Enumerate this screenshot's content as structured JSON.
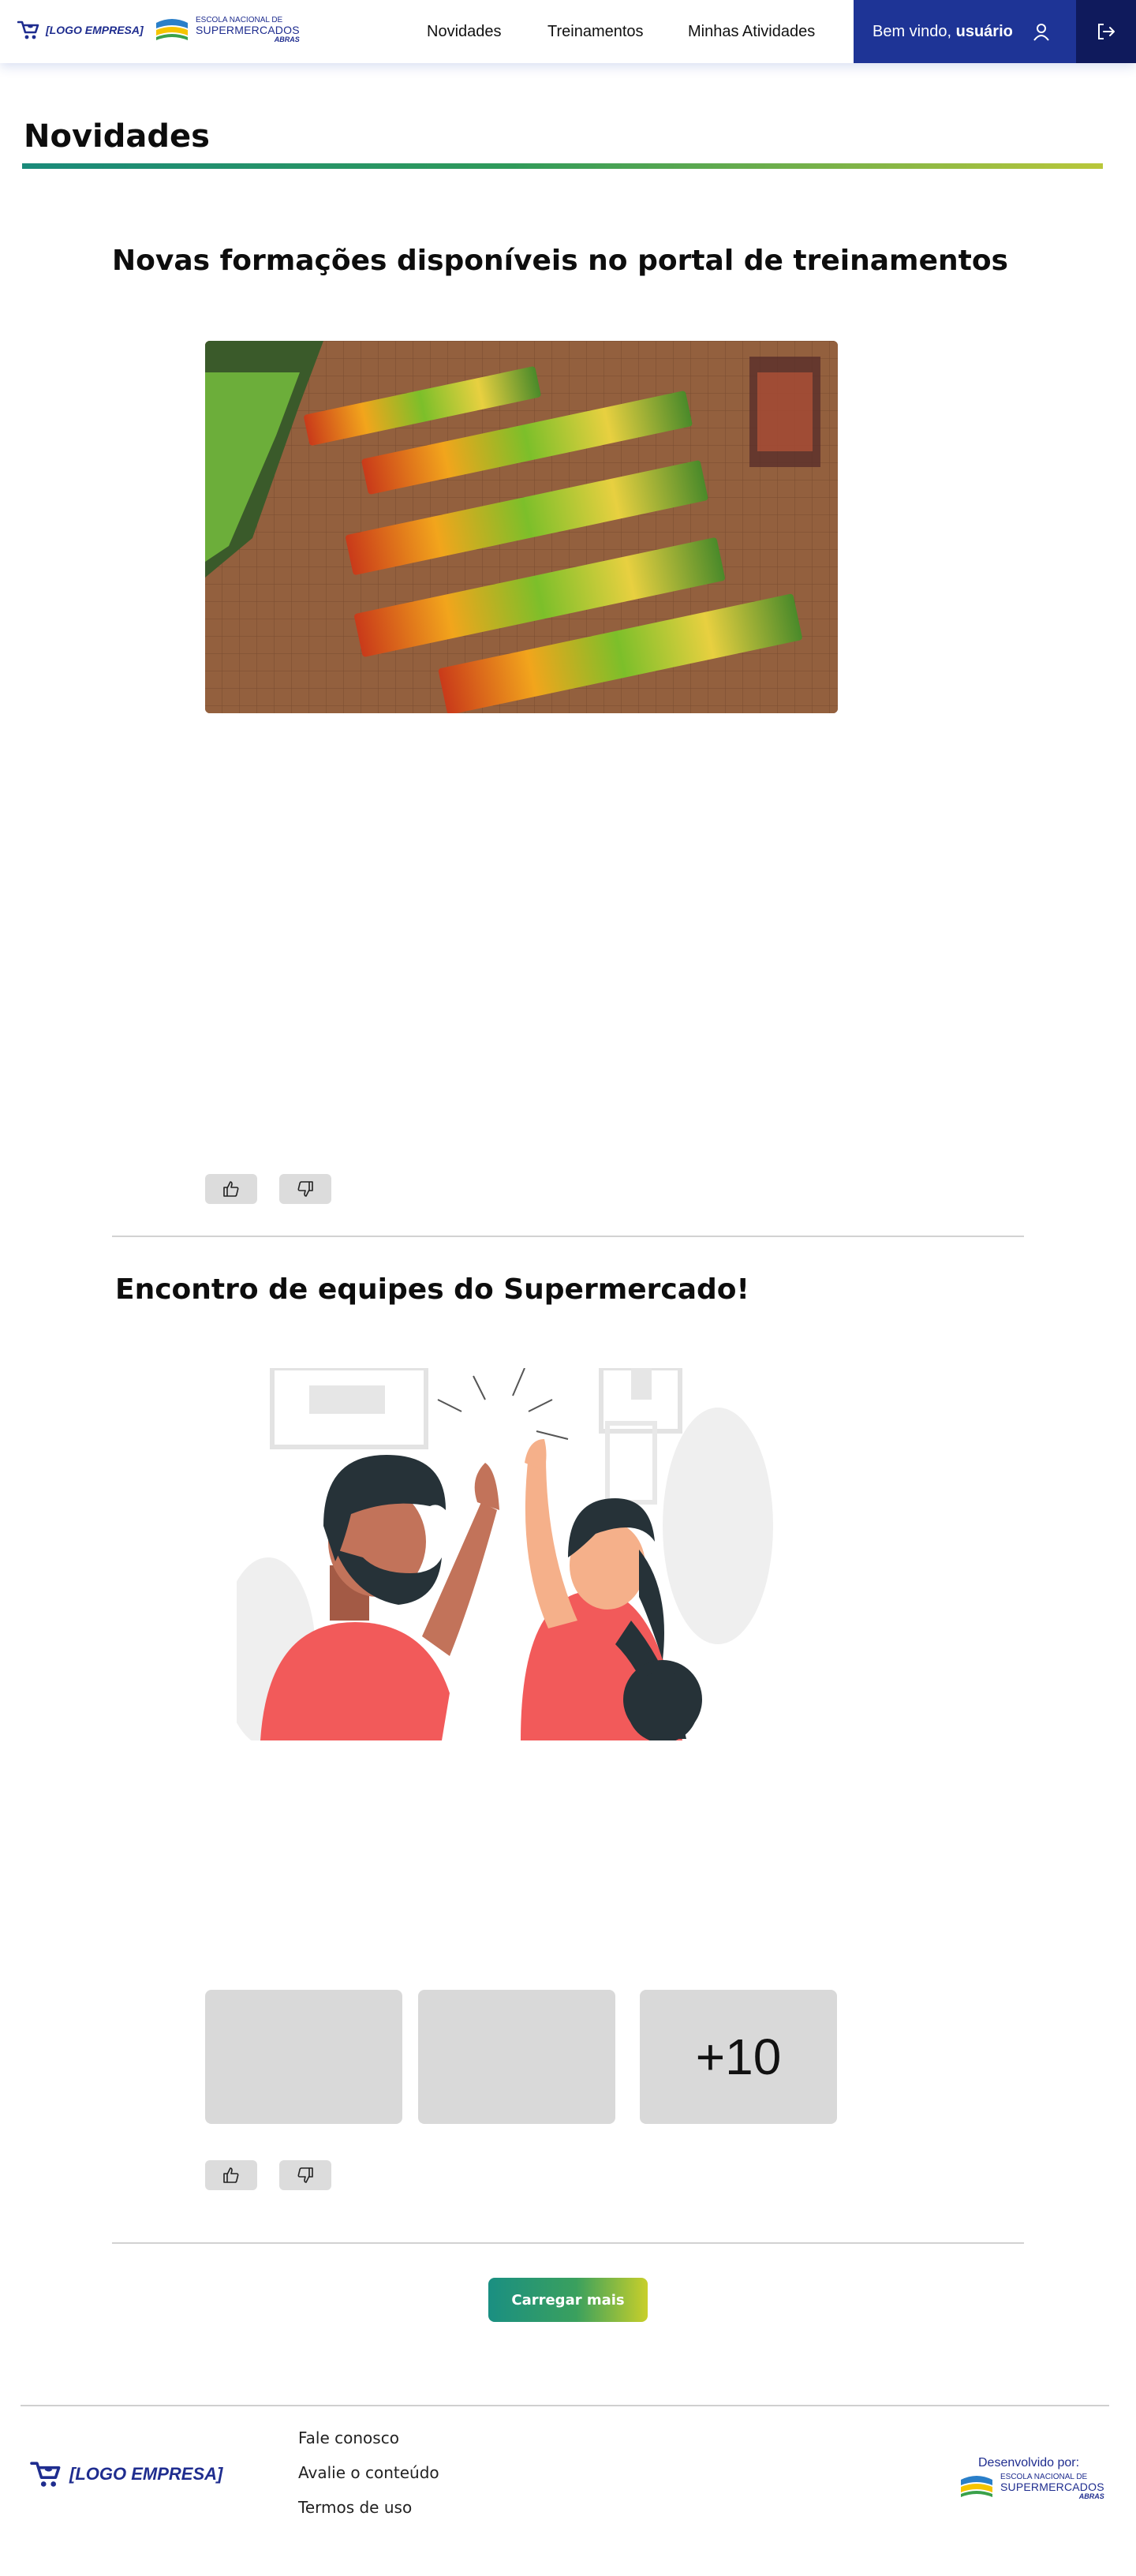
{
  "header": {
    "logo_text": "[LOGO EMPRESA]",
    "escola": {
      "line1": "ESCOLA NACIONAL DE",
      "line2": "SUPERMERCADOS",
      "line3": "ABRAS"
    },
    "nav": [
      "Novidades",
      "Treinamentos",
      "Minhas Atividades"
    ],
    "welcome_prefix": "Bem vindo, ",
    "welcome_user": "usuário",
    "icons": {
      "user": "user-icon",
      "logout": "logout-icon"
    }
  },
  "page": {
    "title": "Novidades"
  },
  "posts": [
    {
      "title": "Novas formações disponíveis no portal de treinamentos",
      "image": "supermarket-produce-aisles-photo",
      "reactions": [
        "thumbs-up-icon",
        "thumbs-down-icon"
      ]
    },
    {
      "title": "Encontro de equipes do Supermercado!",
      "image": "high-five-illustration",
      "more_label": "+10",
      "reactions": [
        "thumbs-up-icon",
        "thumbs-down-icon"
      ]
    }
  ],
  "load_more_label": "Carregar mais",
  "footer": {
    "logo_text": "[LOGO EMPRESA]",
    "links": [
      "Fale conosco",
      "Avalie o conteúdo",
      "Termos de uso"
    ],
    "developed_by": "Desenvolvido por:",
    "escola": {
      "line1": "ESCOLA NACIONAL DE",
      "line2": "SUPERMERCADOS",
      "line3": "ABRAS"
    }
  },
  "colors": {
    "primary_blue": "#1e3496",
    "dark_blue": "#0f1a5c",
    "gradient_start": "#1a8a7a",
    "gradient_end": "#c8cf2a",
    "placeholder_gray": "#d9d9d9"
  }
}
